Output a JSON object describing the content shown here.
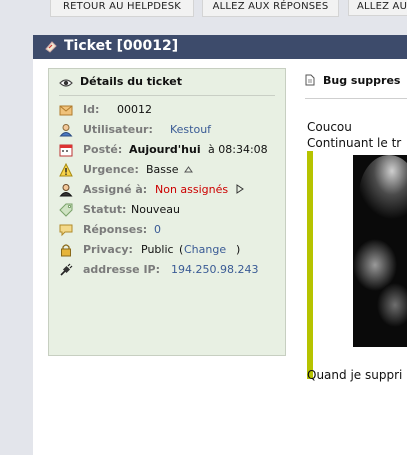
{
  "nav": {
    "btn1": "RETOUR AU HELPDESK",
    "btn2": "ALLEZ AUX RÉPONSES",
    "btn3": "ALLEZ AU"
  },
  "ticket": {
    "title": "Ticket [00012]"
  },
  "details": {
    "heading": "Détails du ticket",
    "rows": {
      "id": {
        "label": "Id:",
        "value": "00012"
      },
      "user": {
        "label": "Utilisateur:",
        "value": "Kestouf"
      },
      "posted": {
        "label": "Posté:",
        "value_bold": "Aujourd'hui",
        "value_rest": "à 08:34:08"
      },
      "urgency": {
        "label": "Urgence:",
        "value": "Basse"
      },
      "assigned": {
        "label": "Assigné à:",
        "value": "Non assignés"
      },
      "status": {
        "label": "Statut:",
        "value": "Nouveau"
      },
      "replies": {
        "label": "Réponses:",
        "value": "0"
      },
      "privacy": {
        "label": "Privacy:",
        "value": "Public",
        "open": "(",
        "link": "Change",
        "close": ")"
      },
      "ip": {
        "label": "addresse IP:",
        "value": "194.250.98.243"
      }
    }
  },
  "message": {
    "subject": "Bug suppres",
    "line1": "Coucou",
    "line2": "Continuant le tr",
    "line3": "Quand je suppri"
  },
  "colors": {
    "titlebar": "#3d4b6b",
    "details_bg": "#e8f0e3",
    "link": "#3a5b95",
    "unassigned": "#cc0000",
    "quote_bar": "#b6c300"
  },
  "icons": [
    "ticket-icon",
    "eye-icon",
    "envelope-icon",
    "user-icon",
    "calendar-icon",
    "warning-icon",
    "assign-user-icon",
    "tag-icon",
    "speech-bubble-icon",
    "lock-icon",
    "plug-icon",
    "document-icon",
    "up-arrow-icon",
    "right-triangle-icon"
  ]
}
